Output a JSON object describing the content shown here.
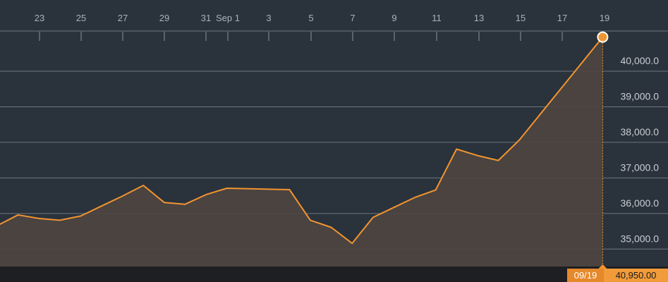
{
  "chart_data": {
    "type": "area",
    "x_tick_labels": [
      "23",
      "25",
      "27",
      "29",
      "31",
      "Sep 1",
      "3",
      "5",
      "7",
      "9",
      "11",
      "13",
      "15",
      "17",
      "19"
    ],
    "y_tick_labels": [
      "35,000.0",
      "36,000.0",
      "37,000.0",
      "38,000.0",
      "39,000.0",
      "40,000.0"
    ],
    "ylim": [
      34500,
      41100
    ],
    "grid": true,
    "series": [
      {
        "x": [
          "08-21",
          "08-22",
          "08-23",
          "08-24",
          "08-25",
          "08-26",
          "08-27",
          "08-28",
          "08-29",
          "08-30",
          "08-31",
          "09-01",
          "09-04",
          "09-05",
          "09-06",
          "09-07",
          "09-08",
          "09-09",
          "09-10",
          "09-11",
          "09-12",
          "09-13",
          "09-14",
          "09-15",
          "09-19"
        ],
        "values": [
          35650,
          35950,
          35850,
          35800,
          35920,
          36200,
          36480,
          36780,
          36300,
          36250,
          36520,
          36700,
          36660,
          35800,
          35600,
          35150,
          35880,
          36160,
          36440,
          36650,
          37800,
          37620,
          37480,
          38050,
          40950
        ]
      }
    ],
    "last": {
      "date": "09/19",
      "value": "40,950.00"
    },
    "colors": {
      "line": "#f2942f",
      "fill": "#4e4540",
      "grid": "#6f7680",
      "background": "#2a323c",
      "bottom_bar": "#1e1f22"
    }
  }
}
